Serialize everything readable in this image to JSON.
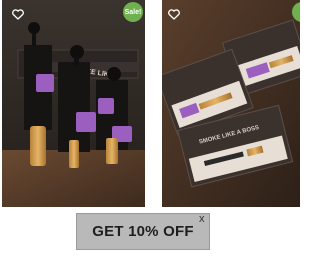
{
  "products": [
    {
      "badge": "Sale!",
      "wishlist_icon": "heart-outline-icon",
      "photo_text": "SMOKE LIKE A"
    },
    {
      "badge": "",
      "wishlist_icon": "heart-outline-icon",
      "photo_text": "SMOKE LIKE A BOSS"
    }
  ],
  "promo": {
    "label": "GET 10% OFF",
    "close_label": "x"
  },
  "colors": {
    "sale_badge": "#6fb04f",
    "promo_background": "#b9b9b9",
    "accent_purple": "#9b5fc0"
  }
}
